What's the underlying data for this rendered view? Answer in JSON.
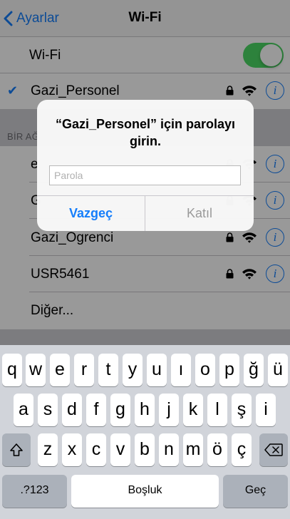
{
  "nav": {
    "back_label": "Ayarlar",
    "title": "Wi-Fi"
  },
  "wifi_toggle": {
    "label": "Wi-Fi",
    "on": true
  },
  "connected_network": {
    "name": "Gazi_Personel",
    "secured": true
  },
  "section_header": "BİR AĞ",
  "networks": [
    {
      "name": "e",
      "secured": true
    },
    {
      "name": "G",
      "secured": true
    },
    {
      "name": "Gazi_Ogrenci",
      "secured": true
    },
    {
      "name": "USR5461",
      "secured": true
    }
  ],
  "other_label": "Diğer...",
  "alert": {
    "message": "“Gazi_Personel” için parolayı girin.",
    "password_placeholder": "Parola",
    "password_value": "",
    "cancel_label": "Vazgeç",
    "join_label": "Katıl"
  },
  "keyboard": {
    "row1": [
      "q",
      "w",
      "e",
      "r",
      "t",
      "y",
      "u",
      "ı",
      "o",
      "p",
      "ğ",
      "ü"
    ],
    "row2": [
      "a",
      "s",
      "d",
      "f",
      "g",
      "h",
      "j",
      "k",
      "l",
      "ş",
      "i"
    ],
    "row3": [
      "z",
      "x",
      "c",
      "v",
      "b",
      "n",
      "m",
      "ö",
      "ç"
    ],
    "numbers_label": ".?123",
    "space_label": "Boşluk",
    "go_label": "Geç"
  },
  "colors": {
    "accent": "#157efb",
    "toggle_on": "#4cd964"
  },
  "icons": [
    "chevron-left-icon",
    "checkmark-icon",
    "lock-icon",
    "wifi-icon",
    "info-icon",
    "shift-icon",
    "backspace-icon"
  ]
}
